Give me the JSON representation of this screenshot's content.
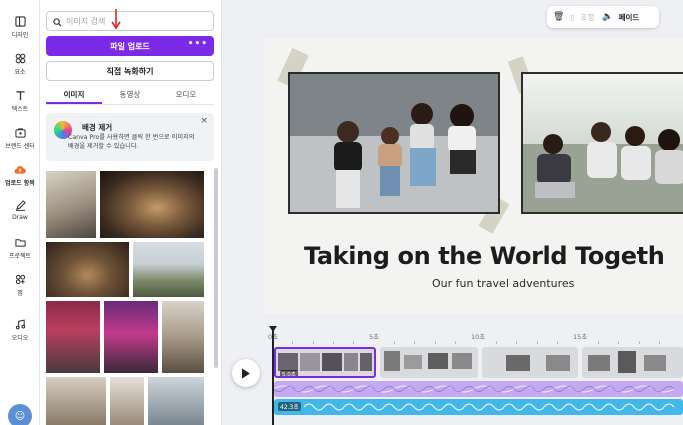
{
  "sidebar": {
    "items": [
      {
        "label": "디자인",
        "icon": "layout-icon"
      },
      {
        "label": "요소",
        "icon": "elements-icon"
      },
      {
        "label": "텍스트",
        "icon": "text-icon"
      },
      {
        "label": "브랜드 센터",
        "icon": "brand-icon"
      },
      {
        "label": "업로드 항목",
        "icon": "upload-cloud-icon"
      },
      {
        "label": "Draw",
        "icon": "pen-icon"
      },
      {
        "label": "프로젝트",
        "icon": "folder-icon"
      },
      {
        "label": "앱",
        "icon": "apps-icon"
      },
      {
        "label": "오디오",
        "icon": "music-icon"
      }
    ]
  },
  "panel": {
    "search_placeholder": "이미지 검색",
    "upload_button": "파일 업로드",
    "upload_more": "•••",
    "record_button": "직접 녹화하기",
    "tabs": [
      {
        "label": "이미지",
        "active": true
      },
      {
        "label": "동영상",
        "active": false
      },
      {
        "label": "오디오",
        "active": false
      }
    ],
    "promo": {
      "title": "배경 제거",
      "body": "Canva Pro를 사용하면 클릭 한 번으로 이미지의 배경을 제거할 수 있습니다.",
      "close": "×"
    }
  },
  "topbar": {
    "adjust_label": "조정",
    "fade_label": "페이드"
  },
  "slide": {
    "headline": "Taking on the World Togeth",
    "subline": "Our fun travel adventures"
  },
  "timeline": {
    "ruler": [
      "0초",
      "5초",
      "10초",
      "15초"
    ],
    "clip_badge": "5.0초",
    "audio_badge": "42.3초"
  },
  "colors": {
    "accent": "#7d2ae8",
    "audio_purple": "#c4a9f2",
    "audio_blue": "#42b7e8"
  }
}
